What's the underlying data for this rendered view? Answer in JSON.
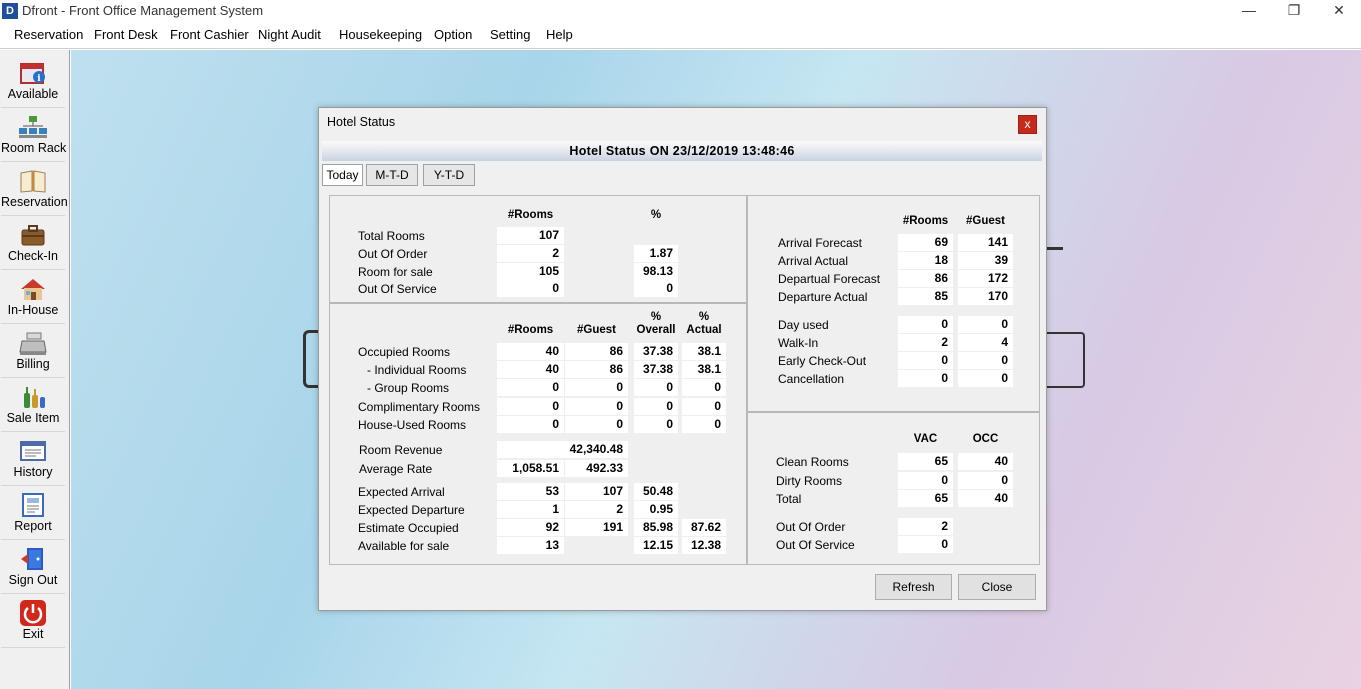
{
  "window": {
    "title": "Dfront - Front Office Management System",
    "icon": "app-logo-icon",
    "minimize": "—",
    "restore": "❐",
    "close": "✕"
  },
  "menu": [
    "Reservation",
    "Front Desk",
    "Front Cashier",
    "Night Audit",
    "Housekeeping",
    "Option",
    "Setting",
    "Help"
  ],
  "sidebar": [
    {
      "label": "Available",
      "icon": "calendar-info-icon"
    },
    {
      "label": "Room Rack",
      "icon": "room-rack-icon"
    },
    {
      "label": "Reservation",
      "icon": "book-icon"
    },
    {
      "label": "Check-In",
      "icon": "briefcase-icon"
    },
    {
      "label": "In-House",
      "icon": "house-icon"
    },
    {
      "label": "Billing",
      "icon": "cash-register-icon"
    },
    {
      "label": "Sale Item",
      "icon": "bottles-icon"
    },
    {
      "label": "History",
      "icon": "history-icon"
    },
    {
      "label": "Report",
      "icon": "report-icon"
    },
    {
      "label": "Sign Out",
      "icon": "door-icon"
    },
    {
      "label": "Exit",
      "icon": "power-icon"
    }
  ],
  "dialog": {
    "title": "Hotel Status",
    "close": "x",
    "banner": "Hotel Status  ON  23/12/2019 13:48:46",
    "tabs": [
      "Today",
      "M-T-D",
      "Y-T-D"
    ],
    "rooms_panel": {
      "headers": {
        "rooms": "#Rooms",
        "pct": "%"
      },
      "rows": [
        {
          "label": "Total Rooms",
          "rooms": "107",
          "pct": null
        },
        {
          "label": "Out Of Order",
          "rooms": "2",
          "pct": "1.87"
        },
        {
          "label": "Room for sale",
          "rooms": "105",
          "pct": "98.13"
        },
        {
          "label": "Out Of Service",
          "rooms": "0",
          "pct": "0"
        }
      ]
    },
    "occupancy_panel": {
      "headers": {
        "rooms": "#Rooms",
        "guest": "#Guest",
        "overall_pct": "%",
        "overall": "Overall",
        "actual_pct": "%",
        "actual": "Actual"
      },
      "rows": [
        {
          "label": "Occupied Rooms",
          "rooms": "40",
          "guest": "86",
          "overall": "37.38",
          "actual": "38.1"
        },
        {
          "label": "- Individual Rooms",
          "rooms": "40",
          "guest": "86",
          "overall": "37.38",
          "actual": "38.1"
        },
        {
          "label": "- Group Rooms",
          "rooms": "0",
          "guest": "0",
          "overall": "0",
          "actual": "0"
        },
        {
          "label": "Complimentary Rooms",
          "rooms": "0",
          "guest": "0",
          "overall": "0",
          "actual": "0"
        },
        {
          "label": "House-Used Rooms",
          "rooms": "0",
          "guest": "0",
          "overall": "0",
          "actual": "0"
        }
      ],
      "room_revenue": {
        "label": "Room Revenue",
        "value": "42,340.48"
      },
      "average_rate": {
        "label": "Average Rate",
        "value1": "1,058.51",
        "value2": "492.33"
      },
      "expected": [
        {
          "label": "Expected Arrival",
          "rooms": "53",
          "guest": "107",
          "overall": "50.48",
          "actual": null
        },
        {
          "label": "Expected Departure",
          "rooms": "1",
          "guest": "2",
          "overall": "0.95",
          "actual": null
        },
        {
          "label": "Estimate Occupied",
          "rooms": "92",
          "guest": "191",
          "overall": "85.98",
          "actual": "87.62"
        },
        {
          "label": "Available for sale",
          "rooms": "13",
          "guest": null,
          "overall": "12.15",
          "actual": "12.38"
        }
      ]
    },
    "arrival_panel": {
      "headers": {
        "rooms": "#Rooms",
        "guest": "#Guest"
      },
      "rows": [
        {
          "label": "Arrival Forecast",
          "rooms": "69",
          "guest": "141"
        },
        {
          "label": "Arrival Actual",
          "rooms": "18",
          "guest": "39"
        },
        {
          "label": "Departual Forecast",
          "rooms": "86",
          "guest": "172"
        },
        {
          "label": "Departure Actual",
          "rooms": "85",
          "guest": "170"
        }
      ],
      "rows2": [
        {
          "label": "Day used",
          "rooms": "0",
          "guest": "0"
        },
        {
          "label": "Walk-In",
          "rooms": "2",
          "guest": "4"
        },
        {
          "label": "Early Check-Out",
          "rooms": "0",
          "guest": "0"
        },
        {
          "label": "Cancellation",
          "rooms": "0",
          "guest": "0"
        }
      ]
    },
    "housekeeping_panel": {
      "headers": {
        "vac": "VAC",
        "occ": "OCC"
      },
      "rows": [
        {
          "label": "Clean Rooms",
          "vac": "65",
          "occ": "40"
        },
        {
          "label": "Dirty Rooms",
          "vac": "0",
          "occ": "0"
        },
        {
          "label": "Total",
          "vac": "65",
          "occ": "40"
        }
      ],
      "out_of_order": {
        "label": "Out Of Order",
        "value": "2"
      },
      "out_of_service": {
        "label": "Out Of Service",
        "value": "0"
      }
    },
    "buttons": {
      "refresh": "Refresh",
      "close": "Close"
    }
  }
}
